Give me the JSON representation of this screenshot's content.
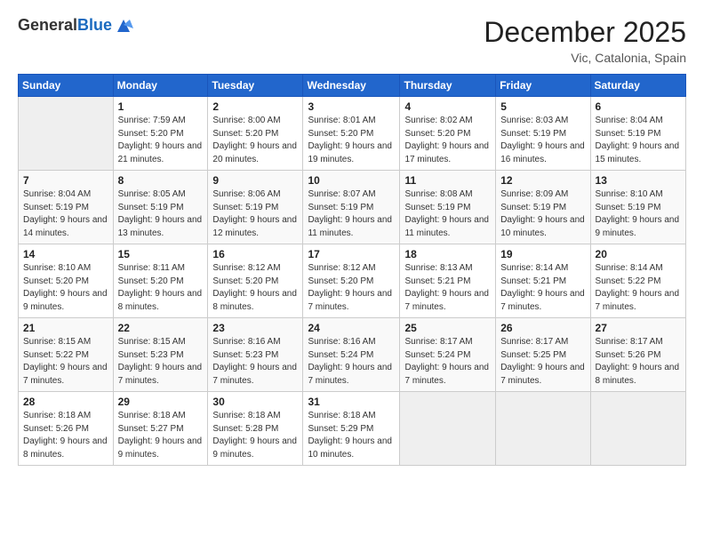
{
  "logo": {
    "general": "General",
    "blue": "Blue"
  },
  "title": "December 2025",
  "location": "Vic, Catalonia, Spain",
  "days_header": [
    "Sunday",
    "Monday",
    "Tuesday",
    "Wednesday",
    "Thursday",
    "Friday",
    "Saturday"
  ],
  "weeks": [
    [
      {
        "num": "",
        "empty": true
      },
      {
        "num": "1",
        "sunrise": "Sunrise: 7:59 AM",
        "sunset": "Sunset: 5:20 PM",
        "daylight": "Daylight: 9 hours and 21 minutes."
      },
      {
        "num": "2",
        "sunrise": "Sunrise: 8:00 AM",
        "sunset": "Sunset: 5:20 PM",
        "daylight": "Daylight: 9 hours and 20 minutes."
      },
      {
        "num": "3",
        "sunrise": "Sunrise: 8:01 AM",
        "sunset": "Sunset: 5:20 PM",
        "daylight": "Daylight: 9 hours and 19 minutes."
      },
      {
        "num": "4",
        "sunrise": "Sunrise: 8:02 AM",
        "sunset": "Sunset: 5:20 PM",
        "daylight": "Daylight: 9 hours and 17 minutes."
      },
      {
        "num": "5",
        "sunrise": "Sunrise: 8:03 AM",
        "sunset": "Sunset: 5:19 PM",
        "daylight": "Daylight: 9 hours and 16 minutes."
      },
      {
        "num": "6",
        "sunrise": "Sunrise: 8:04 AM",
        "sunset": "Sunset: 5:19 PM",
        "daylight": "Daylight: 9 hours and 15 minutes."
      }
    ],
    [
      {
        "num": "7",
        "sunrise": "Sunrise: 8:04 AM",
        "sunset": "Sunset: 5:19 PM",
        "daylight": "Daylight: 9 hours and 14 minutes."
      },
      {
        "num": "8",
        "sunrise": "Sunrise: 8:05 AM",
        "sunset": "Sunset: 5:19 PM",
        "daylight": "Daylight: 9 hours and 13 minutes."
      },
      {
        "num": "9",
        "sunrise": "Sunrise: 8:06 AM",
        "sunset": "Sunset: 5:19 PM",
        "daylight": "Daylight: 9 hours and 12 minutes."
      },
      {
        "num": "10",
        "sunrise": "Sunrise: 8:07 AM",
        "sunset": "Sunset: 5:19 PM",
        "daylight": "Daylight: 9 hours and 11 minutes."
      },
      {
        "num": "11",
        "sunrise": "Sunrise: 8:08 AM",
        "sunset": "Sunset: 5:19 PM",
        "daylight": "Daylight: 9 hours and 11 minutes."
      },
      {
        "num": "12",
        "sunrise": "Sunrise: 8:09 AM",
        "sunset": "Sunset: 5:19 PM",
        "daylight": "Daylight: 9 hours and 10 minutes."
      },
      {
        "num": "13",
        "sunrise": "Sunrise: 8:10 AM",
        "sunset": "Sunset: 5:19 PM",
        "daylight": "Daylight: 9 hours and 9 minutes."
      }
    ],
    [
      {
        "num": "14",
        "sunrise": "Sunrise: 8:10 AM",
        "sunset": "Sunset: 5:20 PM",
        "daylight": "Daylight: 9 hours and 9 minutes."
      },
      {
        "num": "15",
        "sunrise": "Sunrise: 8:11 AM",
        "sunset": "Sunset: 5:20 PM",
        "daylight": "Daylight: 9 hours and 8 minutes."
      },
      {
        "num": "16",
        "sunrise": "Sunrise: 8:12 AM",
        "sunset": "Sunset: 5:20 PM",
        "daylight": "Daylight: 9 hours and 8 minutes."
      },
      {
        "num": "17",
        "sunrise": "Sunrise: 8:12 AM",
        "sunset": "Sunset: 5:20 PM",
        "daylight": "Daylight: 9 hours and 7 minutes."
      },
      {
        "num": "18",
        "sunrise": "Sunrise: 8:13 AM",
        "sunset": "Sunset: 5:21 PM",
        "daylight": "Daylight: 9 hours and 7 minutes."
      },
      {
        "num": "19",
        "sunrise": "Sunrise: 8:14 AM",
        "sunset": "Sunset: 5:21 PM",
        "daylight": "Daylight: 9 hours and 7 minutes."
      },
      {
        "num": "20",
        "sunrise": "Sunrise: 8:14 AM",
        "sunset": "Sunset: 5:22 PM",
        "daylight": "Daylight: 9 hours and 7 minutes."
      }
    ],
    [
      {
        "num": "21",
        "sunrise": "Sunrise: 8:15 AM",
        "sunset": "Sunset: 5:22 PM",
        "daylight": "Daylight: 9 hours and 7 minutes."
      },
      {
        "num": "22",
        "sunrise": "Sunrise: 8:15 AM",
        "sunset": "Sunset: 5:23 PM",
        "daylight": "Daylight: 9 hours and 7 minutes."
      },
      {
        "num": "23",
        "sunrise": "Sunrise: 8:16 AM",
        "sunset": "Sunset: 5:23 PM",
        "daylight": "Daylight: 9 hours and 7 minutes."
      },
      {
        "num": "24",
        "sunrise": "Sunrise: 8:16 AM",
        "sunset": "Sunset: 5:24 PM",
        "daylight": "Daylight: 9 hours and 7 minutes."
      },
      {
        "num": "25",
        "sunrise": "Sunrise: 8:17 AM",
        "sunset": "Sunset: 5:24 PM",
        "daylight": "Daylight: 9 hours and 7 minutes."
      },
      {
        "num": "26",
        "sunrise": "Sunrise: 8:17 AM",
        "sunset": "Sunset: 5:25 PM",
        "daylight": "Daylight: 9 hours and 7 minutes."
      },
      {
        "num": "27",
        "sunrise": "Sunrise: 8:17 AM",
        "sunset": "Sunset: 5:26 PM",
        "daylight": "Daylight: 9 hours and 8 minutes."
      }
    ],
    [
      {
        "num": "28",
        "sunrise": "Sunrise: 8:18 AM",
        "sunset": "Sunset: 5:26 PM",
        "daylight": "Daylight: 9 hours and 8 minutes."
      },
      {
        "num": "29",
        "sunrise": "Sunrise: 8:18 AM",
        "sunset": "Sunset: 5:27 PM",
        "daylight": "Daylight: 9 hours and 9 minutes."
      },
      {
        "num": "30",
        "sunrise": "Sunrise: 8:18 AM",
        "sunset": "Sunset: 5:28 PM",
        "daylight": "Daylight: 9 hours and 9 minutes."
      },
      {
        "num": "31",
        "sunrise": "Sunrise: 8:18 AM",
        "sunset": "Sunset: 5:29 PM",
        "daylight": "Daylight: 9 hours and 10 minutes."
      },
      {
        "num": "",
        "empty": true
      },
      {
        "num": "",
        "empty": true
      },
      {
        "num": "",
        "empty": true
      }
    ]
  ]
}
